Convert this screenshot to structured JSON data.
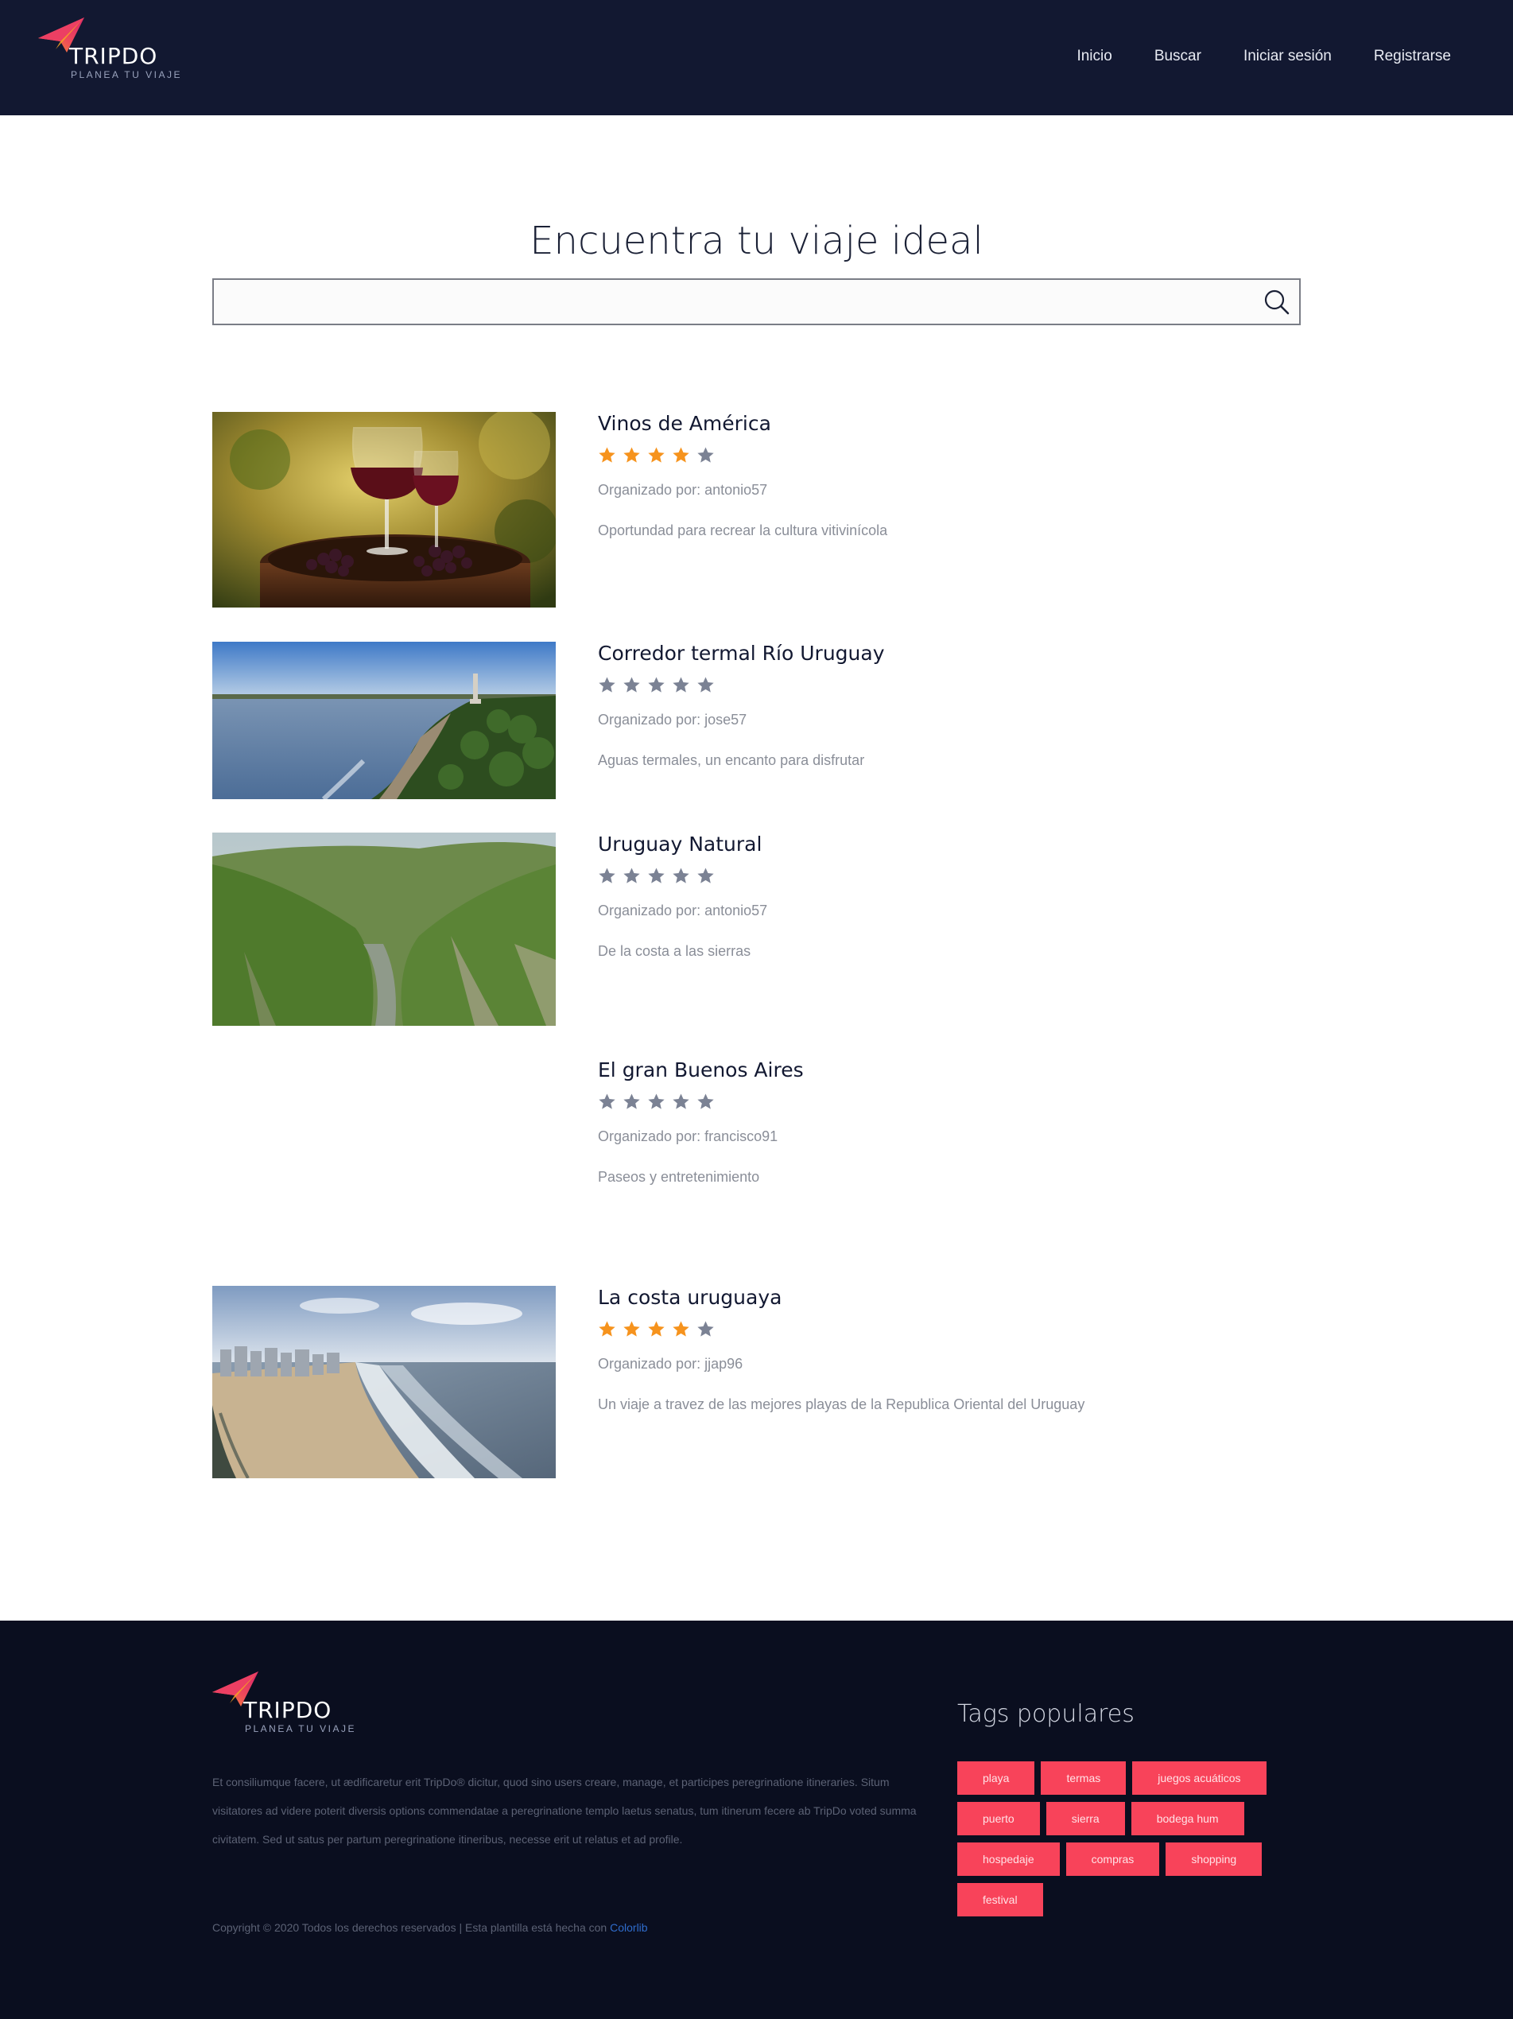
{
  "header": {
    "brand": "TRIPDO",
    "tagline": "PLANEA TU VIAJE",
    "nav": [
      "Inicio",
      "Buscar",
      "Iniciar sesión",
      "Registrarse"
    ]
  },
  "search": {
    "title": "Encuentra tu viaje ideal",
    "value": "",
    "placeholder": ""
  },
  "trips": [
    {
      "title": "Vinos de América",
      "rating": 4,
      "max_rating": 5,
      "organizer": "Organizado por: antonio57",
      "description": "Oportundad para recrear la cultura vitivinícola",
      "image": "wine-glasses-photo"
    },
    {
      "title": "Corredor termal Río Uruguay",
      "rating": 0,
      "max_rating": 5,
      "organizer": "Organizado por: jose57",
      "description": "Aguas termales, un encanto para disfrutar",
      "image": "river-aerial-photo"
    },
    {
      "title": "Uruguay Natural",
      "rating": 0,
      "max_rating": 5,
      "organizer": "Organizado por: antonio57",
      "description": "De la costa a las sierras",
      "image": "green-valley-photo"
    },
    {
      "title": "El gran Buenos Aires",
      "rating": 0,
      "max_rating": 5,
      "organizer": "Organizado por: francisco91",
      "description": "Paseos y entretenimiento",
      "image": ""
    },
    {
      "title": "La costa uruguaya",
      "rating": 4,
      "max_rating": 5,
      "organizer": "Organizado por: jjap96",
      "description": "Un viaje a travez de las mejores playas de la Republica Oriental del Uruguay",
      "image": "beach-coast-photo"
    }
  ],
  "footer": {
    "brand": "TRIPDO",
    "tagline": "PLANEA TU VIAJE",
    "about": "Et consiliumque facere, ut ædificaretur erit TripDo® dicitur, quod sino users creare, manage, et participes peregrinatione itineraries. Situm visitatores ad videre poterit diversis options commendatae a peregrinatione templo laetus senatus, tum itinerum fecere ab TripDo voted summa civitatem. Sed ut satus per partum peregrinatione itineribus, necesse erit ut relatus et ad profile.",
    "copyright": "Copyright © 2020 Todos los derechos reservados | Esta plantilla está hecha con ",
    "copyright_link": "Colorlib",
    "tags_title": "Tags populares",
    "tags": [
      "playa",
      "termas",
      "juegos acuáticos",
      "puerto",
      "sierra",
      "bodega hum",
      "hospedaje",
      "compras",
      "shopping",
      "festival"
    ]
  },
  "colors": {
    "header_bg": "#121831",
    "footer_bg": "#0a0e1f",
    "star_active": "#f6931d",
    "star_inactive": "#7b8294",
    "tag_bg": "#f8435a",
    "link": "#2f6ccc"
  }
}
